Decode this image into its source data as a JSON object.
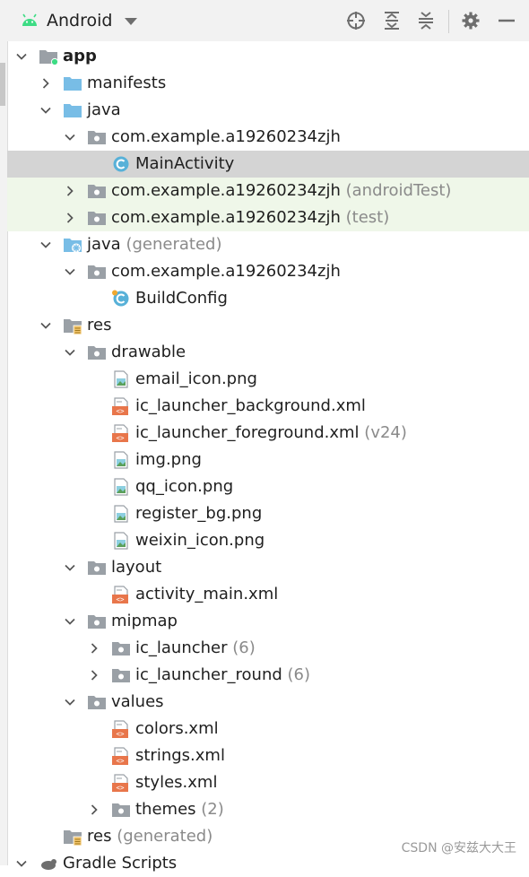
{
  "toolbar": {
    "title": "Android",
    "icons": [
      "android-icon",
      "locate-icon",
      "expand-all-icon",
      "collapse-all-icon",
      "settings-gear-icon",
      "hide-minus-icon"
    ]
  },
  "tree": [
    {
      "depth": 0,
      "arrow": "down",
      "icon": "module-folder",
      "label": "app",
      "bold": true
    },
    {
      "depth": 1,
      "arrow": "right",
      "icon": "folder-blue",
      "label": "manifests"
    },
    {
      "depth": 1,
      "arrow": "down",
      "icon": "folder-blue",
      "label": "java"
    },
    {
      "depth": 2,
      "arrow": "down",
      "icon": "package",
      "label": "com.example.a19260234zjh"
    },
    {
      "depth": 3,
      "arrow": "none",
      "icon": "class",
      "label": "MainActivity",
      "state": "selected"
    },
    {
      "depth": 2,
      "arrow": "right",
      "icon": "package",
      "label": "com.example.a19260234zjh",
      "suffix": "(androidTest)",
      "state": "green"
    },
    {
      "depth": 2,
      "arrow": "right",
      "icon": "package",
      "label": "com.example.a19260234zjh",
      "suffix": "(test)",
      "state": "green"
    },
    {
      "depth": 1,
      "arrow": "down",
      "icon": "folder-generated",
      "label": "java",
      "suffix": "(generated)"
    },
    {
      "depth": 2,
      "arrow": "down",
      "icon": "package",
      "label": "com.example.a19260234zjh"
    },
    {
      "depth": 3,
      "arrow": "none",
      "icon": "class-generated",
      "label": "BuildConfig"
    },
    {
      "depth": 1,
      "arrow": "down",
      "icon": "res-folder",
      "label": "res"
    },
    {
      "depth": 2,
      "arrow": "down",
      "icon": "package",
      "label": "drawable"
    },
    {
      "depth": 3,
      "arrow": "none",
      "icon": "image-file",
      "label": "email_icon.png"
    },
    {
      "depth": 3,
      "arrow": "none",
      "icon": "xml-file",
      "label": "ic_launcher_background.xml"
    },
    {
      "depth": 3,
      "arrow": "none",
      "icon": "xml-file",
      "label": "ic_launcher_foreground.xml",
      "suffix": "(v24)"
    },
    {
      "depth": 3,
      "arrow": "none",
      "icon": "image-file",
      "label": "img.png"
    },
    {
      "depth": 3,
      "arrow": "none",
      "icon": "image-file",
      "label": "qq_icon.png"
    },
    {
      "depth": 3,
      "arrow": "none",
      "icon": "image-file",
      "label": "register_bg.png"
    },
    {
      "depth": 3,
      "arrow": "none",
      "icon": "image-file",
      "label": "weixin_icon.png"
    },
    {
      "depth": 2,
      "arrow": "down",
      "icon": "package",
      "label": "layout"
    },
    {
      "depth": 3,
      "arrow": "none",
      "icon": "xml-file",
      "label": "activity_main.xml"
    },
    {
      "depth": 2,
      "arrow": "down",
      "icon": "package",
      "label": "mipmap"
    },
    {
      "depth": 3,
      "arrow": "right",
      "icon": "package",
      "label": "ic_launcher",
      "suffix": "(6)"
    },
    {
      "depth": 3,
      "arrow": "right",
      "icon": "package",
      "label": "ic_launcher_round",
      "suffix": "(6)"
    },
    {
      "depth": 2,
      "arrow": "down",
      "icon": "package",
      "label": "values"
    },
    {
      "depth": 3,
      "arrow": "none",
      "icon": "xml-file",
      "label": "colors.xml"
    },
    {
      "depth": 3,
      "arrow": "none",
      "icon": "xml-file",
      "label": "strings.xml"
    },
    {
      "depth": 3,
      "arrow": "none",
      "icon": "xml-file",
      "label": "styles.xml"
    },
    {
      "depth": 3,
      "arrow": "right",
      "icon": "package",
      "label": "themes",
      "suffix": "(2)"
    },
    {
      "depth": 1,
      "arrow": "none",
      "icon": "res-folder",
      "label": "res",
      "suffix": "(generated)"
    },
    {
      "depth": 0,
      "arrow": "down",
      "icon": "gradle",
      "label": "Gradle Scripts"
    }
  ],
  "watermark": "CSDN @安兹大大王"
}
